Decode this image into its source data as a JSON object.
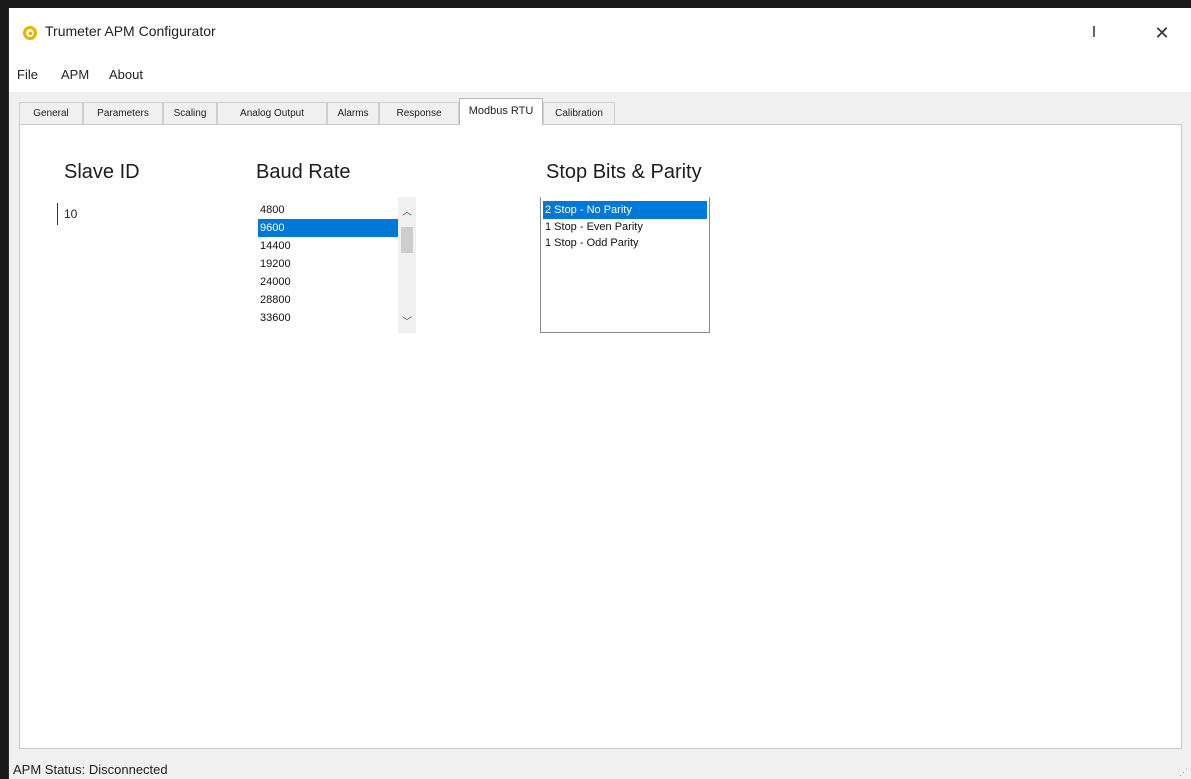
{
  "window": {
    "title": "Trumeter APM Configurator",
    "minimize_label": "I",
    "close_label": "✕"
  },
  "menu": [
    "File",
    "APM",
    "About"
  ],
  "tabs": [
    {
      "label": "General"
    },
    {
      "label": "Parameters"
    },
    {
      "label": "Scaling"
    },
    {
      "label": "Analog Output"
    },
    {
      "label": "Alarms"
    },
    {
      "label": "Response"
    },
    {
      "label": "Modbus RTU",
      "active": true
    },
    {
      "label": "Calibration"
    }
  ],
  "modbus": {
    "slave_id_heading": "Slave ID",
    "slave_id_value": "10",
    "baud_rate_heading": "Baud Rate",
    "baud_rates": [
      "4800",
      "9600",
      "14400",
      "19200",
      "24000",
      "28800",
      "33600"
    ],
    "baud_selected": "9600",
    "stop_parity_heading": "Stop Bits & Parity",
    "stop_parity_options": [
      "2 Stop - No Parity",
      "1 Stop - Even Parity",
      "1 Stop - Odd Parity"
    ],
    "stop_parity_selected": "2 Stop - No Parity"
  },
  "status": {
    "text": "APM Status: Disconnected"
  }
}
